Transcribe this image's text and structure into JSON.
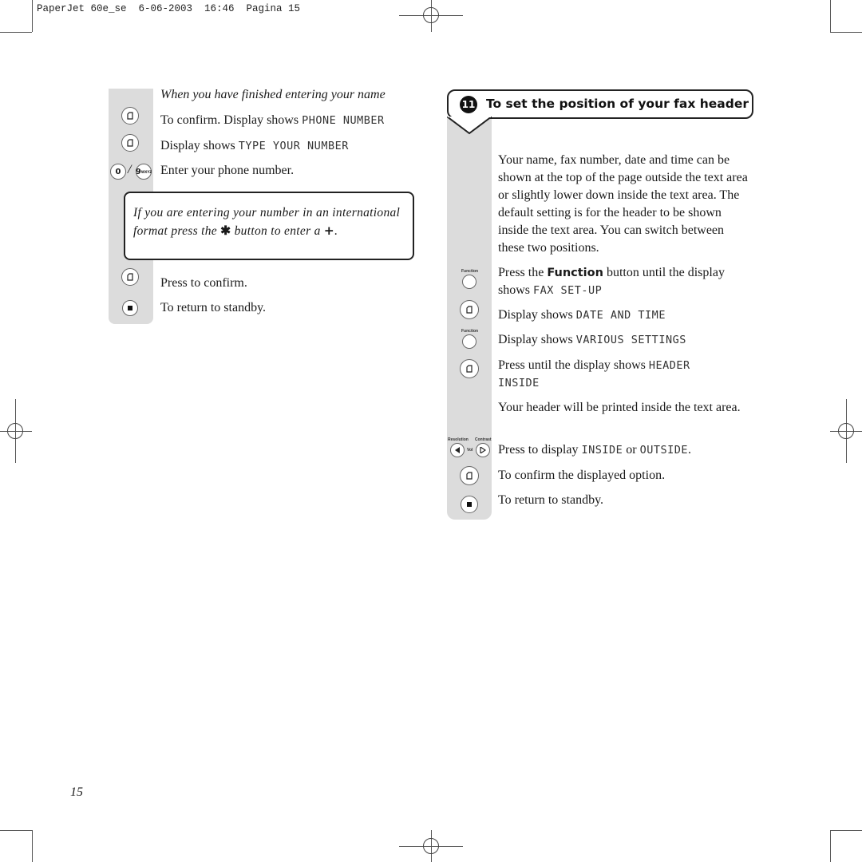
{
  "slug": {
    "text": "PaperJet 60e_se  6-06-2003  16:46  Pagina 15"
  },
  "left_section": {
    "intro": "When you have finished entering your name",
    "steps": [
      {
        "icon": "ok-button-icon",
        "text": "To confirm. Display shows ",
        "display": "PHONE NUMBER"
      },
      {
        "icon": "ok-button-icon",
        "text": "Display shows ",
        "display": "TYPE YOUR NUMBER"
      },
      {
        "icon": "keypad-0-9-icon",
        "text": "Enter your phone number.",
        "display": ""
      }
    ],
    "keypad": {
      "first": "0",
      "sep": "/",
      "last": "9",
      "last_sup": "WXYZ"
    },
    "note": {
      "part1": "If you are entering your number in an international format press the ",
      "star": "✱",
      "part2": " button to enter a ",
      "plus": "+",
      "part3": "."
    },
    "after_steps": [
      {
        "icon": "ok-button-icon",
        "text": "Press to confirm."
      },
      {
        "icon": "stop-button-icon",
        "text": "To return to standby."
      }
    ]
  },
  "right_section": {
    "number": "11",
    "heading": "To set the position of your fax header",
    "intro": "Your name, fax number, date and time can be shown at the top of the page outside the text area or slightly lower down inside the text area. The default setting is for the header to be shown inside the text area. You can switch between these two positions.",
    "steps": [
      {
        "icon": "function-button-icon",
        "label": "Function",
        "pre": "Press the ",
        "bold": "Function",
        "post": " button until the display shows ",
        "display": "FAX SET-UP"
      },
      {
        "icon": "ok-button-icon",
        "pre": "Display shows ",
        "display": "DATE AND TIME"
      },
      {
        "icon": "function-button-icon",
        "label": "Function",
        "pre": "Display shows ",
        "display": "VARIOUS SETTINGS"
      },
      {
        "icon": "ok-button-icon",
        "pre": "Press until the display shows ",
        "display": "HEADER INSIDE"
      },
      {
        "icon": "",
        "pre": "Your header will be printed inside the text area."
      },
      {
        "icon": "resolution-contrast-buttons-icon",
        "labels": [
          "Resolution",
          "Vol",
          "Contrast"
        ],
        "pre": "Press to display ",
        "display": "INSIDE",
        "mid": " or ",
        "display2": "OUTSIDE",
        "post": "."
      },
      {
        "icon": "ok-button-icon",
        "pre": "To confirm the displayed option."
      },
      {
        "icon": "stop-button-icon",
        "pre": "To return to standby."
      }
    ]
  },
  "footer": {
    "page_number": "15"
  }
}
